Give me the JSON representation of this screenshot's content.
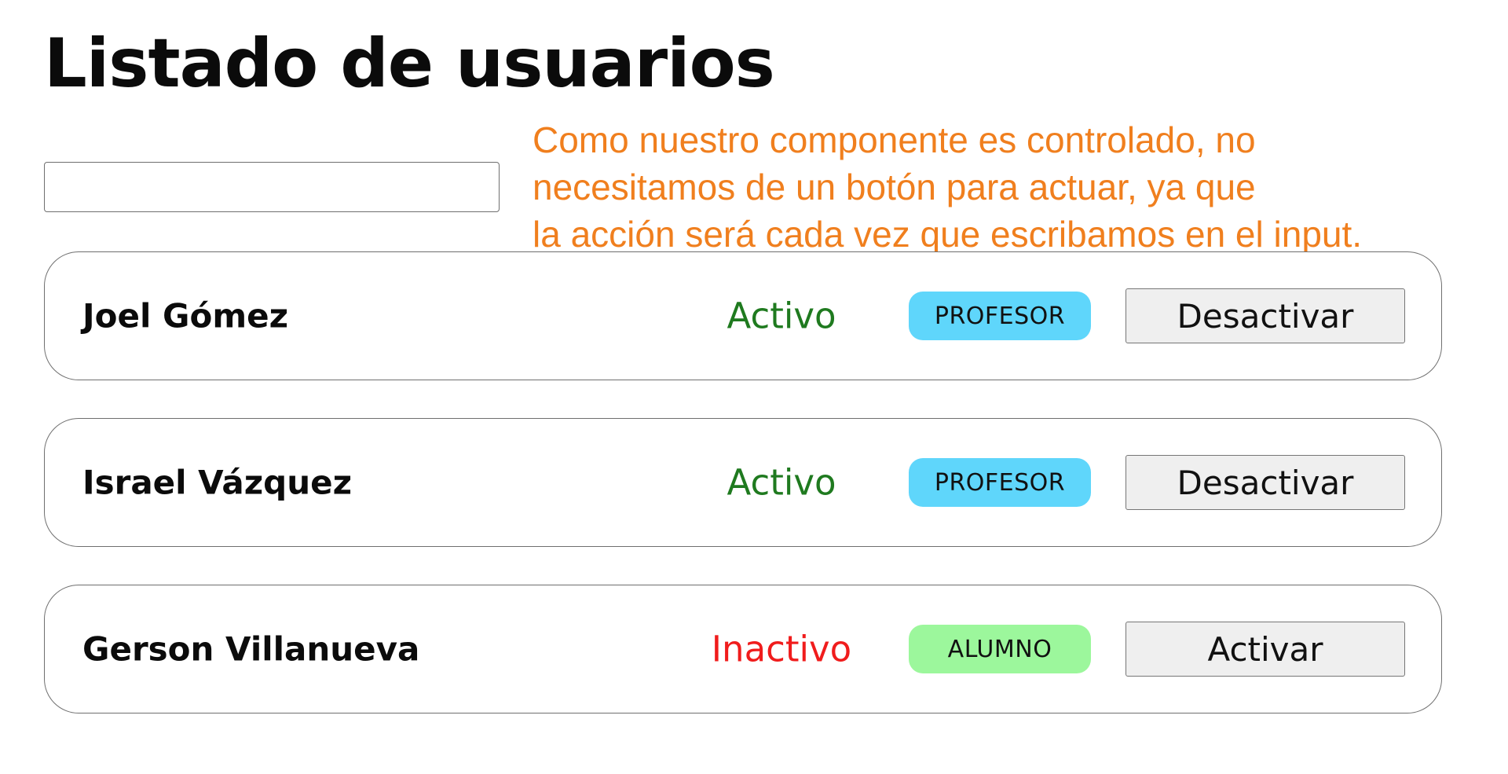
{
  "page": {
    "title": "Listado de usuarios"
  },
  "search": {
    "value": "",
    "placeholder": ""
  },
  "annotation": {
    "lines": [
      "Como nuestro componente es controlado, no",
      "necesitamos de un botón para actuar, ya que",
      "la acción será cada vez que escribamos en el input."
    ],
    "color": "#f07f1e"
  },
  "colors": {
    "active": "#1f7a1f",
    "inactive": "#f01c1c",
    "badge_profesor": "#5fd6fb",
    "badge_alumno": "#9cf79c"
  },
  "users": [
    {
      "name": "Joel Gómez",
      "status": "Activo",
      "status_key": "active",
      "role": "PROFESOR",
      "role_key": "profesor",
      "action": "Desactivar"
    },
    {
      "name": "Israel Vázquez",
      "status": "Activo",
      "status_key": "active",
      "role": "PROFESOR",
      "role_key": "profesor",
      "action": "Desactivar"
    },
    {
      "name": "Gerson Villanueva",
      "status": "Inactivo",
      "status_key": "inactive",
      "role": "ALUMNO",
      "role_key": "alumno",
      "action": "Activar"
    }
  ]
}
